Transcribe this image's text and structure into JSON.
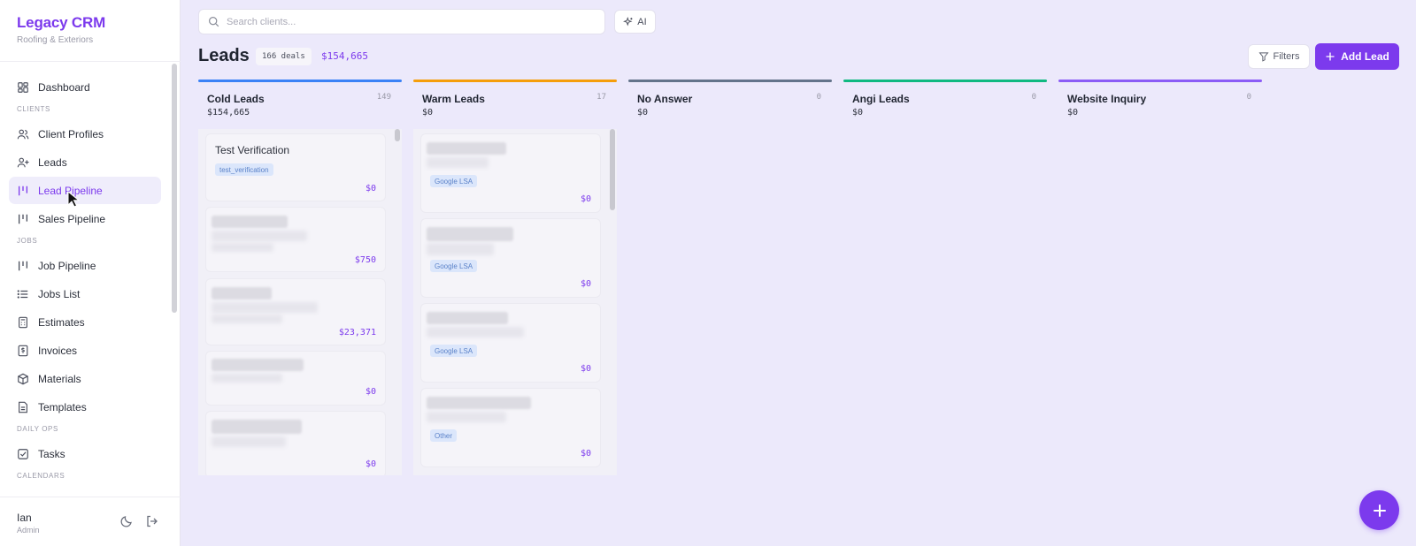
{
  "brand": {
    "title": "Legacy CRM",
    "subtitle": "Roofing & Exteriors"
  },
  "sidebar": {
    "items": [
      {
        "label": "Dashboard",
        "icon": "dashboard-icon"
      },
      {
        "label": "Client Profiles",
        "icon": "users-icon"
      },
      {
        "label": "Leads",
        "icon": "user-plus-icon"
      },
      {
        "label": "Lead Pipeline",
        "icon": "kanban-icon",
        "active": true
      },
      {
        "label": "Sales Pipeline",
        "icon": "kanban-icon"
      },
      {
        "label": "Job Pipeline",
        "icon": "kanban-icon"
      },
      {
        "label": "Jobs List",
        "icon": "list-icon"
      },
      {
        "label": "Estimates",
        "icon": "calculator-icon"
      },
      {
        "label": "Invoices",
        "icon": "invoice-icon"
      },
      {
        "label": "Materials",
        "icon": "package-icon"
      },
      {
        "label": "Templates",
        "icon": "file-icon"
      },
      {
        "label": "Tasks",
        "icon": "checkbox-icon"
      }
    ],
    "sections": {
      "clients": "CLIENTS",
      "jobs": "JOBS",
      "daily_ops": "DAILY OPS",
      "calendars": "CALENDARS"
    }
  },
  "user": {
    "name": "Ian",
    "role": "Admin"
  },
  "search": {
    "placeholder": "Search clients..."
  },
  "ai_label": "AI",
  "header": {
    "title": "Leads",
    "deals": "166 deals",
    "total": "$154,665"
  },
  "actions": {
    "filters": "Filters",
    "add": "Add Lead"
  },
  "columns": [
    {
      "name": "Cold Leads",
      "count": "149",
      "total": "$154,665",
      "color": "#3b82f6"
    },
    {
      "name": "Warm Leads",
      "count": "17",
      "total": "$0",
      "color": "#f59e0b"
    },
    {
      "name": "No Answer",
      "count": "0",
      "total": "$0",
      "color": "#64748b"
    },
    {
      "name": "Angi Leads",
      "count": "0",
      "total": "$0",
      "color": "#10b981"
    },
    {
      "name": "Website Inquiry",
      "count": "0",
      "total": "$0",
      "color": "#8b5cf6"
    }
  ],
  "cold_cards": [
    {
      "title": "Test Verification",
      "tag": "test_verification",
      "value": "$0"
    },
    {
      "value": "$750"
    },
    {
      "value": "$23,371"
    },
    {
      "value": "$0"
    },
    {
      "value": "$0"
    }
  ],
  "warm_cards": [
    {
      "tag": "Google LSA",
      "value": "$0"
    },
    {
      "tag": "Google LSA",
      "value": "$0"
    },
    {
      "tag": "Google LSA",
      "value": "$0"
    },
    {
      "tag": "Other",
      "value": "$0"
    }
  ],
  "colors": {
    "accent": "#7c3aed",
    "background": "#ece9fb"
  }
}
